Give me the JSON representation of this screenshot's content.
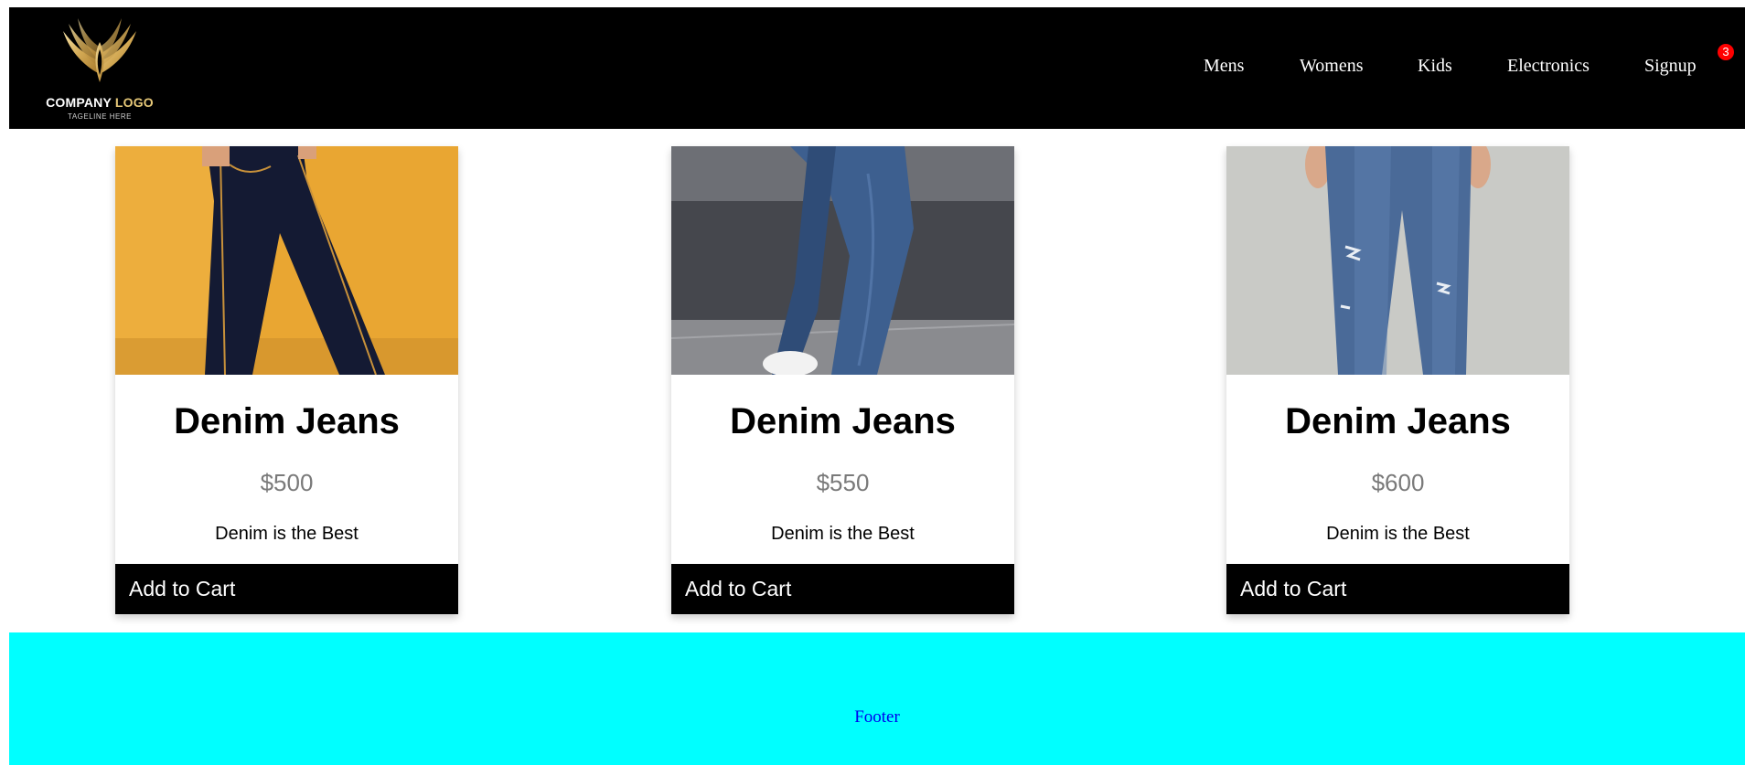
{
  "header": {
    "logo": {
      "title_main": "COMPANY ",
      "title_accent": "LOGO",
      "tagline": "TAGELINE HERE",
      "icon": "winged-emblem-icon"
    },
    "nav": [
      {
        "label": "Mens"
      },
      {
        "label": "Womens"
      },
      {
        "label": "Kids"
      },
      {
        "label": "Electronics"
      },
      {
        "label": "Signup"
      }
    ],
    "cart_count": "3"
  },
  "products": [
    {
      "title": "Denim Jeans",
      "price": "$500",
      "description": "Denim is the Best",
      "button": "Add to Cart"
    },
    {
      "title": "Denim Jeans",
      "price": "$550",
      "description": "Denim is the Best",
      "button": "Add to Cart"
    },
    {
      "title": "Denim Jeans",
      "price": "$600",
      "description": "Denim is the Best",
      "button": "Add to Cart"
    }
  ],
  "footer": {
    "text": "Footer"
  },
  "colors": {
    "header_bg": "#000000",
    "footer_bg": "#00ffff",
    "footer_text": "#0000ee",
    "badge": "#ff0000",
    "button_bg": "#000000",
    "price": "#7a7a7a"
  }
}
